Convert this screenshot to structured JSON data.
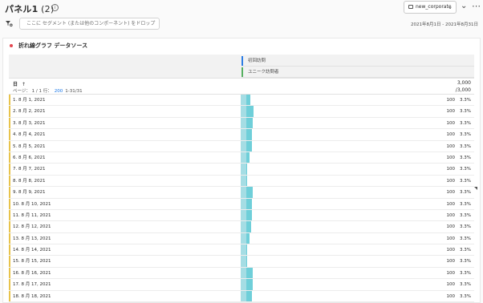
{
  "panel": {
    "title": "パネル1",
    "count": " (2)",
    "info_glyph": "i",
    "report_suite": "new_corporate",
    "chevron_glyph": "⌄",
    "collapse_glyph": "⌄",
    "more_glyph": "⋯"
  },
  "segment_bar": {
    "placeholder": "ここに セグメント (または他のコンポーネント) をドロップ",
    "date_range": "2021年8月1日 - 2021年8月31日"
  },
  "visualization": {
    "title": "折れ線グラフ データソース",
    "metrics": [
      {
        "label": "初回訪問",
        "color": "#2d7de4"
      },
      {
        "label": "ユニーク訪問者",
        "color": "#57b061"
      }
    ],
    "dimension": {
      "name": "日",
      "sort_glyph": "↑",
      "pager_prefix": "ページ： 1 / 1 行：",
      "rows_per_page": "200",
      "range": "1-31/31"
    },
    "totals": {
      "value": "3,000",
      "out_of": "/3,000"
    },
    "rows": [
      {
        "label": "1.  8 月 1, 2021",
        "value": "100",
        "pct": "3.3%",
        "extra": 0.55
      },
      {
        "label": "2.  8 月 2, 2021",
        "value": "100",
        "pct": "3.3%",
        "extra": 1.0
      },
      {
        "label": "3.  8 月 3, 2021",
        "value": "100",
        "pct": "3.3%",
        "extra": 0.85
      },
      {
        "label": "4.  8 月 4, 2021",
        "value": "100",
        "pct": "3.3%",
        "extra": 0.75
      },
      {
        "label": "5.  8 月 5, 2021",
        "value": "100",
        "pct": "3.3%",
        "extra": 0.8
      },
      {
        "label": "6.  8 月 6, 2021",
        "value": "100",
        "pct": "3.3%",
        "extra": 0.4
      },
      {
        "label": "7.  8 月 7, 2021",
        "value": "100",
        "pct": "3.3%",
        "extra": 0.1
      },
      {
        "label": "8.  8 月 8, 2021",
        "value": "100",
        "pct": "3.3%",
        "extra": 0.1
      },
      {
        "label": "9.  8 月 9, 2021",
        "value": "100",
        "pct": "3.3%",
        "extra": 0.9
      },
      {
        "label": "10.  8 月 10, 2021",
        "value": "100",
        "pct": "3.3%",
        "extra": 0.8
      },
      {
        "label": "11.  8 月 11, 2021",
        "value": "100",
        "pct": "3.3%",
        "extra": 0.8
      },
      {
        "label": "12.  8 月 12, 2021",
        "value": "100",
        "pct": "3.3%",
        "extra": 0.7
      },
      {
        "label": "13.  8 月 13, 2021",
        "value": "100",
        "pct": "3.3%",
        "extra": 0.45
      },
      {
        "label": "14.  8 月 14, 2021",
        "value": "100",
        "pct": "3.3%",
        "extra": 0.1
      },
      {
        "label": "15.  8 月 15, 2021",
        "value": "100",
        "pct": "3.3%",
        "extra": 0.15
      },
      {
        "label": "16.  8 月 16, 2021",
        "value": "100",
        "pct": "3.3%",
        "extra": 0.9
      },
      {
        "label": "17.  8 月 17, 2021",
        "value": "100",
        "pct": "3.3%",
        "extra": 0.85
      },
      {
        "label": "18.  8 月 18, 2021",
        "value": "100",
        "pct": "3.3%",
        "extra": 0.75
      }
    ]
  }
}
